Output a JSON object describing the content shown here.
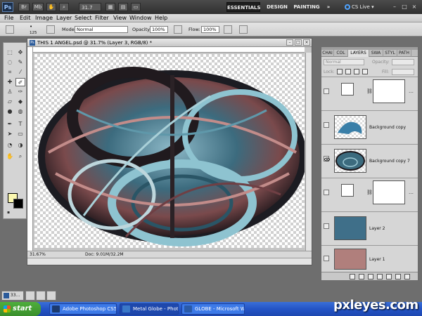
{
  "app": {
    "logo": "Ps",
    "zoom": "31.7",
    "workspaces": [
      "ESSENTIALS",
      "DESIGN",
      "PAINTING"
    ],
    "more": "»",
    "cs_live": "CS Live",
    "cs_live_arrow": "▾",
    "window_controls": [
      "–",
      "□",
      "×"
    ]
  },
  "menu": [
    "File",
    "Edit",
    "Image",
    "Layer",
    "Select",
    "Filter",
    "View",
    "Window",
    "Help"
  ],
  "options": {
    "brush_size": "125",
    "mode_label": "Mode:",
    "mode_value": "Normal",
    "opacity_label": "Opacity:",
    "opacity_value": "100%",
    "flow_label": "Flow:",
    "flow_value": "100%"
  },
  "document": {
    "icon": "Ps",
    "title": "THIS 1 ANGEL.psd @ 31.7% (Layer 3, RGB/8) *",
    "zoom_status": "31.67%",
    "doc_size": "Doc: 9.01M/32.2M",
    "controls": [
      "–",
      "□",
      "×"
    ]
  },
  "layers_panel": {
    "tabs": [
      "CHAI",
      "COL",
      "LAYERS",
      "SWA",
      "STYL",
      "PATH"
    ],
    "active_tab": "LAYERS",
    "blend_mode": "Normal",
    "opacity_label": "Opacity:",
    "lock_label": "Lock:",
    "fill_label": "Fill:",
    "layers": [
      {
        "name": "",
        "type": "adjustment",
        "visible": false
      },
      {
        "name": "Background copy",
        "type": "image",
        "visible": false
      },
      {
        "name": "Background copy 7",
        "type": "image",
        "visible": true
      },
      {
        "name": "",
        "type": "adjustment",
        "visible": false
      },
      {
        "name": "Layer 2",
        "type": "fill",
        "color": "#3f6f89",
        "visible": false
      },
      {
        "name": "Layer 1",
        "type": "fill",
        "color": "#b07f7c",
        "visible": false
      }
    ]
  },
  "swatches": {
    "foreground": "#fbf8b0",
    "background": "#000000"
  },
  "taskbar": {
    "start": "start",
    "minimized_doc": "33...",
    "tasks": [
      {
        "label": "Adobe Photoshop CS5",
        "icon_color": "#1c3a6e"
      },
      {
        "label": "Metal Globe - Photos...",
        "icon_color": "#3a78c8"
      },
      {
        "label": "GLOBE - Microsoft Word",
        "icon_color": "#2a5aa8"
      }
    ]
  },
  "watermark": "pxleyes.com"
}
